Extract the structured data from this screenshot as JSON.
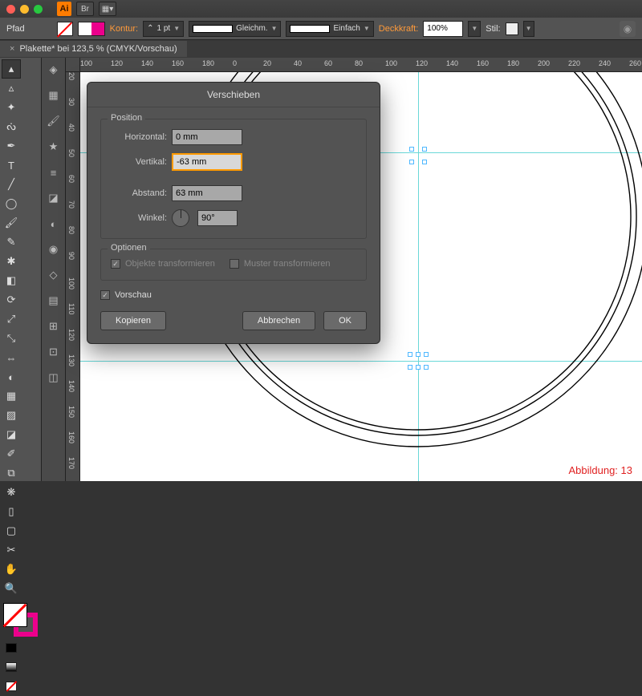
{
  "app": {
    "logo": "Ai",
    "bridge": "Br"
  },
  "controlbar": {
    "path_label": "Pfad",
    "kontur_label": "Kontur:",
    "kontur_weight": "1 pt",
    "profile1": "Gleichm.",
    "profile2": "Einfach",
    "deckkraft_label": "Deckkraft:",
    "deckkraft_value": "100%",
    "stil_label": "Stil:"
  },
  "doctab": {
    "title": "Plakette* bei 123,5 % (CMYK/Vorschau)"
  },
  "ruler_h": [
    "100",
    "120",
    "140",
    "160",
    "180",
    "0",
    "20",
    "40",
    "60",
    "80",
    "100",
    "120",
    "140",
    "160",
    "180",
    "200",
    "220",
    "240",
    "260"
  ],
  "ruler_v": [
    "20",
    "30",
    "40",
    "50",
    "60",
    "70",
    "80",
    "90",
    "100",
    "110",
    "120",
    "130",
    "140",
    "150",
    "160",
    "170"
  ],
  "dialog": {
    "title": "Verschieben",
    "position_legend": "Position",
    "horizontal_label": "Horizontal:",
    "horizontal_value": "0 mm",
    "vertikal_label": "Vertikal:",
    "vertikal_value": "-63 mm",
    "abstand_label": "Abstand:",
    "abstand_value": "63 mm",
    "winkel_label": "Winkel:",
    "winkel_value": "90°",
    "optionen_legend": "Optionen",
    "objekte_label": "Objekte transformieren",
    "muster_label": "Muster transformieren",
    "vorschau_label": "Vorschau",
    "kopieren": "Kopieren",
    "abbrechen": "Abbrechen",
    "ok": "OK"
  },
  "caption": "Abbildung: 13"
}
